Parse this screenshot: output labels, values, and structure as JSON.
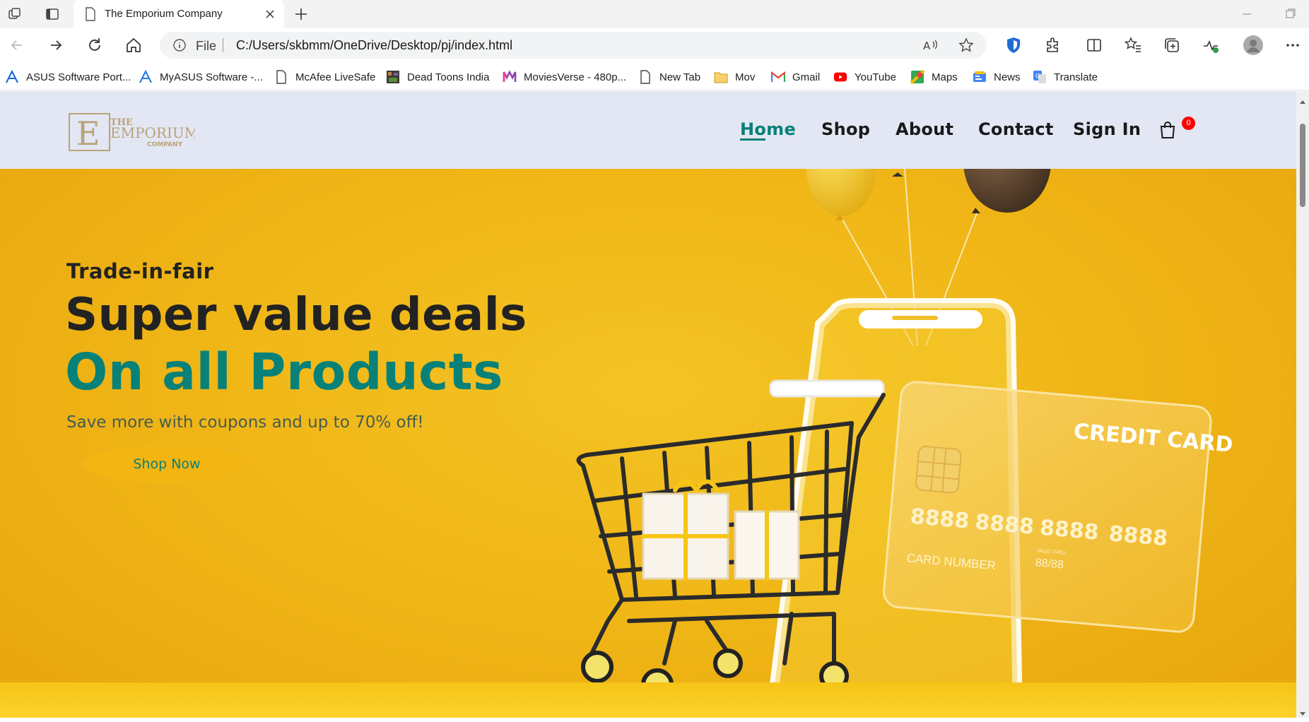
{
  "browser": {
    "tab_title": "The Emporium Company",
    "address": {
      "scheme_label": "File",
      "url": "C:/Users/skbmm/OneDrive/Desktop/pj/index.html"
    },
    "bookmarks": [
      {
        "label": "ASUS Software Port...",
        "icon": "asus-icon"
      },
      {
        "label": "MyASUS Software -...",
        "icon": "myasus-icon"
      },
      {
        "label": "McAfee LiveSafe",
        "icon": "page-icon"
      },
      {
        "label": "Dead Toons India",
        "icon": "deadtoons-icon"
      },
      {
        "label": "MoviesVerse - 480p...",
        "icon": "moviesverse-icon"
      },
      {
        "label": "New Tab",
        "icon": "page-icon"
      },
      {
        "label": "Mov",
        "icon": "folder-icon"
      },
      {
        "label": "Gmail",
        "icon": "gmail-icon"
      },
      {
        "label": "YouTube",
        "icon": "youtube-icon"
      },
      {
        "label": "Maps",
        "icon": "maps-icon"
      },
      {
        "label": "News",
        "icon": "news-icon"
      },
      {
        "label": "Translate",
        "icon": "translate-icon"
      }
    ]
  },
  "site": {
    "logo": {
      "line1": "THE",
      "line2": "EMPORIUM",
      "line3": "COMPANY",
      "initial": "E"
    },
    "nav": [
      {
        "label": "Home",
        "active": true
      },
      {
        "label": "Shop",
        "active": false
      },
      {
        "label": "About",
        "active": false
      },
      {
        "label": "Contact",
        "active": false
      },
      {
        "label": "Sign In",
        "active": false
      }
    ],
    "cart_count": "0",
    "hero": {
      "subtitle": "Trade-in-fair",
      "headline": "Super value deals",
      "headline_accent": "On all Products",
      "description": "Save more with coupons and up to 70% off!",
      "cta": "Shop Now",
      "card": {
        "title": "CREDIT CARD",
        "number_groups": [
          "8888",
          "8888",
          "8888",
          "8888"
        ],
        "expiry": "88/88",
        "valid_label": "VALID THRU",
        "number_label": "CARD NUMBER"
      }
    }
  },
  "colors": {
    "accent": "#088178",
    "header_bg": "#e3e6f3",
    "hero_bg": "#f0b717",
    "badge": "#ff0000"
  }
}
